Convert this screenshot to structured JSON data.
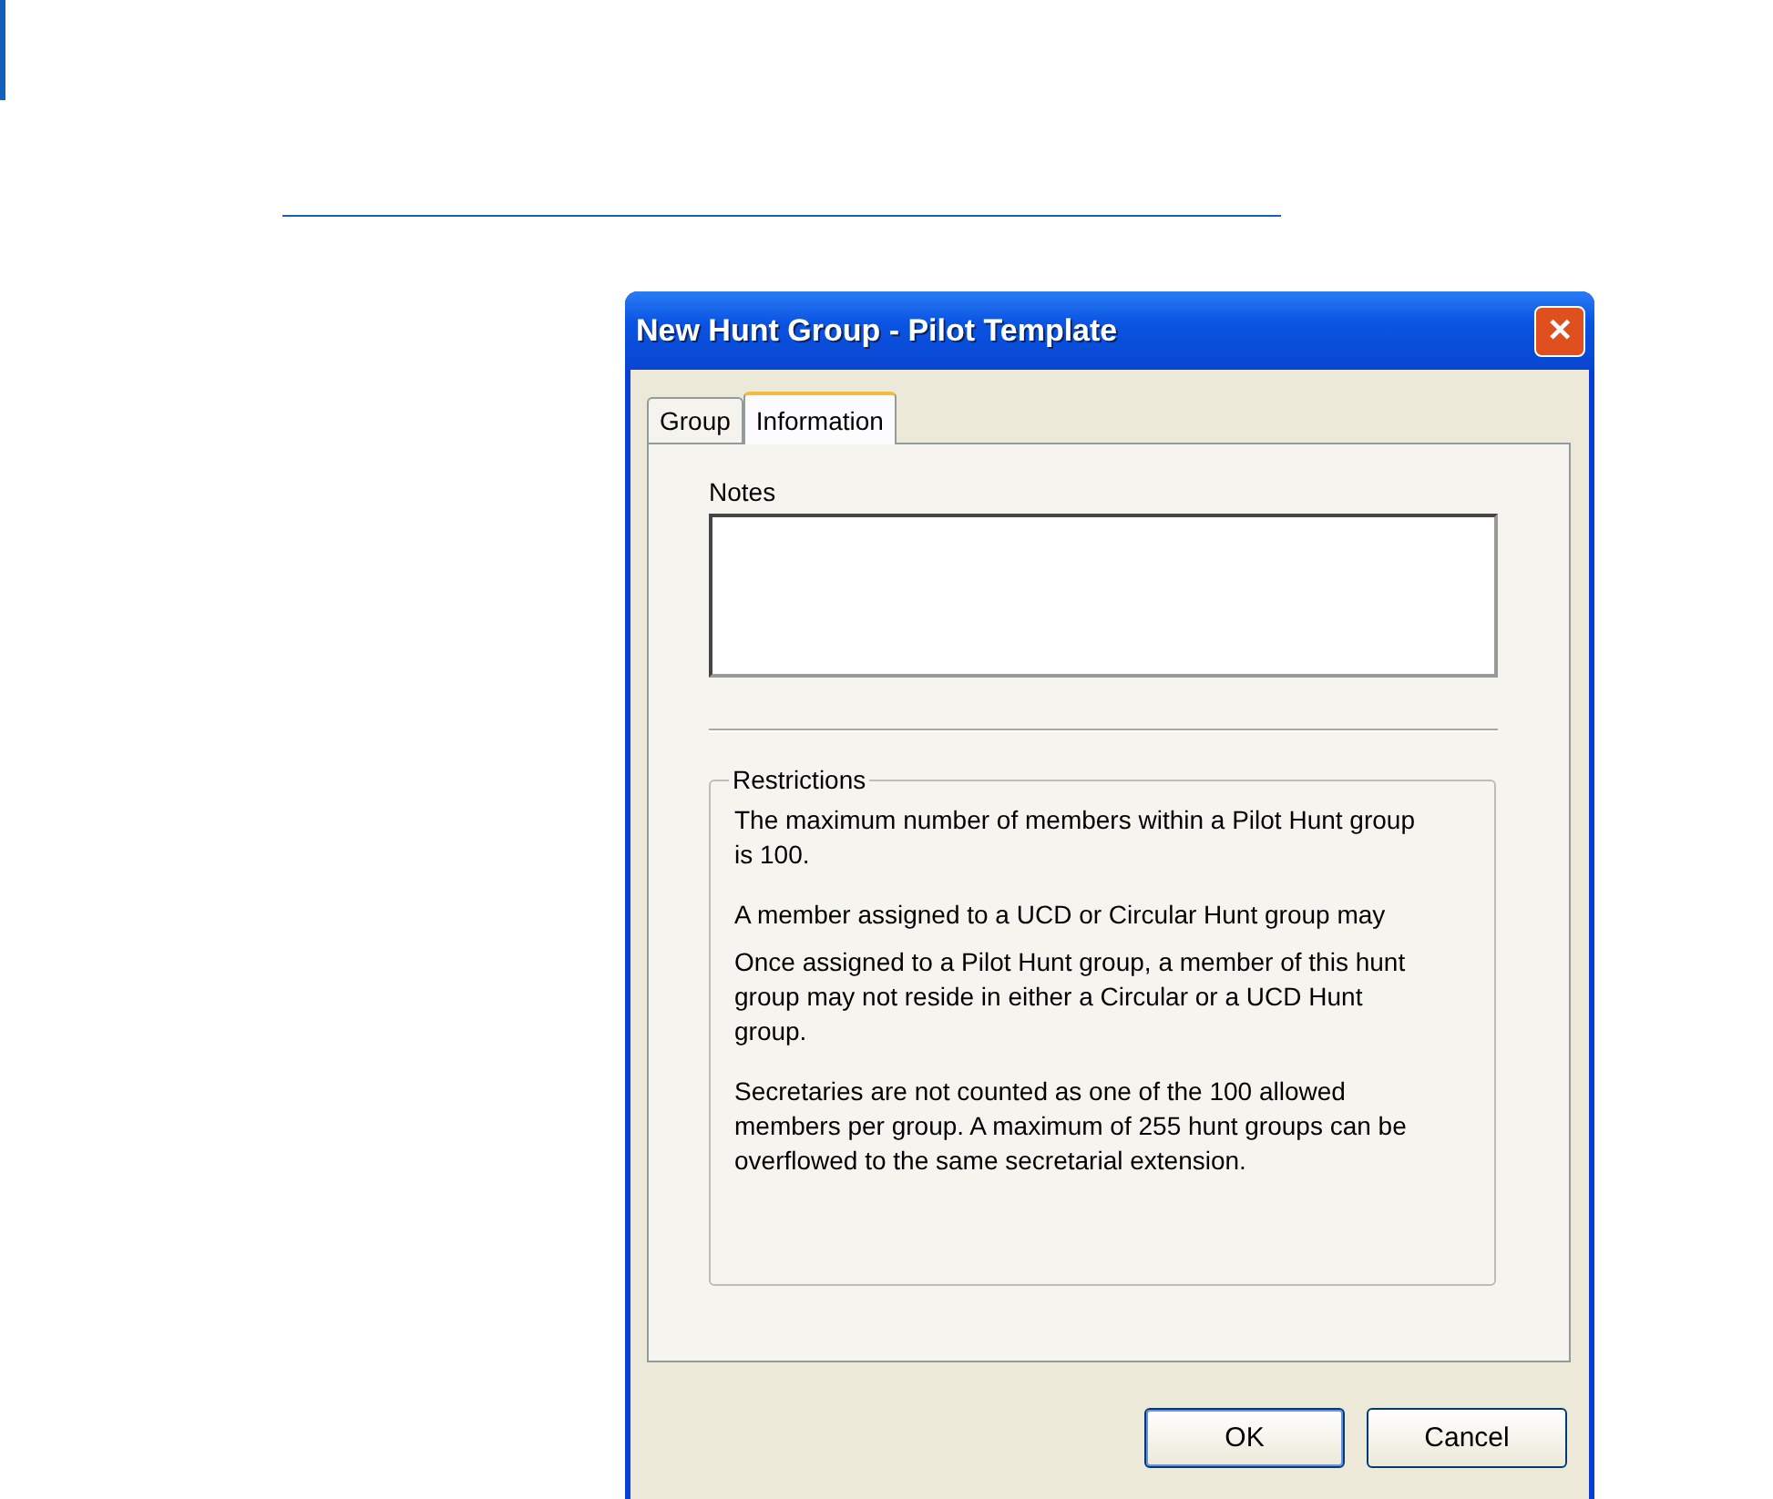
{
  "window": {
    "title": "New Hunt Group - Pilot Template",
    "close": "✕"
  },
  "tabs": [
    {
      "label": "Group",
      "selected": false
    },
    {
      "label": "Information",
      "selected": true
    }
  ],
  "notes": {
    "label": "Notes"
  },
  "restrictions": {
    "title": "Restrictions",
    "paragraphs": [
      "The maximum number of members within a Pilot Hunt group is 100.",
      "A member assigned to a UCD or Circular Hunt group may",
      "Once assigned to a Pilot Hunt group, a member of this hunt group may not reside in either a Circular or a UCD Hunt group.",
      "Secretaries are not counted as one of the 100 allowed members per group. A maximum of 255 hunt groups can be overflowed to the same secretarial extension."
    ]
  },
  "buttons": [
    {
      "label": "OK",
      "default": true
    },
    {
      "label": "Cancel",
      "default": false
    }
  ]
}
